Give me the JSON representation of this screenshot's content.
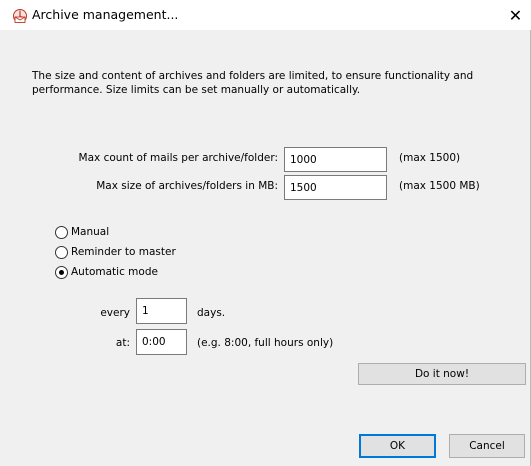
{
  "window": {
    "title": "Archive management...",
    "close_glyph": "✕"
  },
  "description": "The size and content of archives and folders are limited, to ensure functionality and performance. Size limits can be set manually or automatically.",
  "limits": {
    "max_count_label": "Max count of mails per archive/folder:",
    "max_count_value": "1000",
    "max_count_hint": "(max 1500)",
    "max_size_label": "Max size of archives/folders in MB:",
    "max_size_value": "1500",
    "max_size_hint": "(max 1500 MB)"
  },
  "modes": {
    "selected": "Automatic mode",
    "options": [
      "Manual",
      "Reminder to master",
      "Automatic mode"
    ]
  },
  "schedule": {
    "every_label": "every",
    "every_value": "1",
    "days_label": "days.",
    "at_label": "at:",
    "at_value": "0:00",
    "at_hint": "(e.g. 8:00, full hours only)"
  },
  "buttons": {
    "do_it_now": "Do it now!",
    "ok": "OK",
    "cancel": "Cancel"
  },
  "icons": {
    "title_icon": "archive-management-icon",
    "close_icon": "close-icon"
  }
}
